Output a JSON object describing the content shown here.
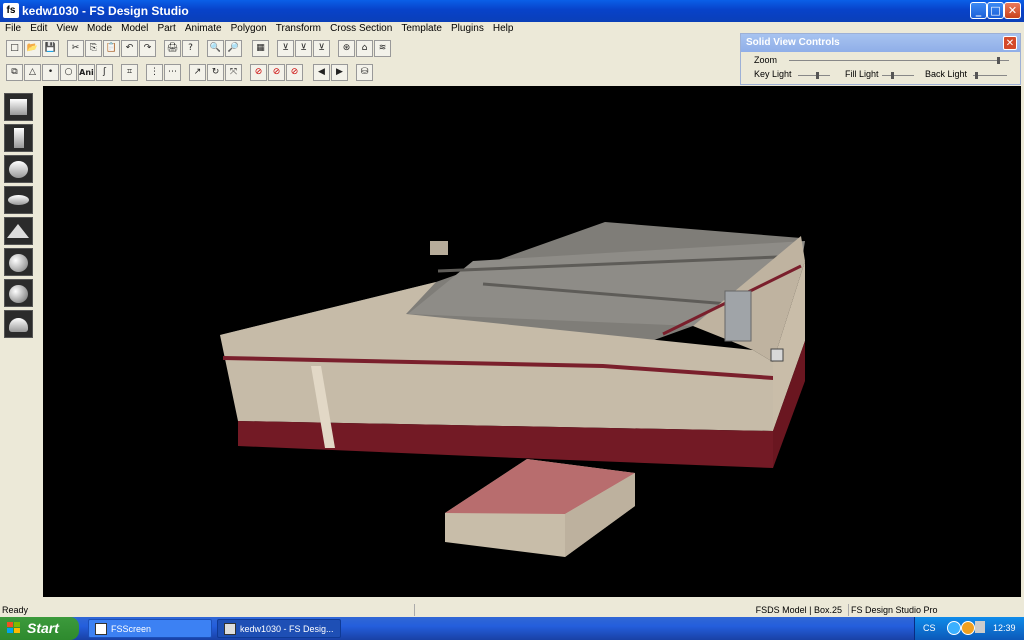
{
  "window": {
    "title": "kedw1030 - FS Design Studio",
    "app_icon_text": "fs",
    "min": "_",
    "max": "□",
    "close": "✕"
  },
  "menu": [
    "File",
    "Edit",
    "View",
    "Mode",
    "Model",
    "Part",
    "Animate",
    "Polygon",
    "Transform",
    "Cross Section",
    "Template",
    "Plugins",
    "Help"
  ],
  "toolbar1": [
    "□",
    "📂",
    "💾",
    "✂",
    "⎘",
    "📋",
    "↶",
    "↷",
    "🖨",
    "?",
    "🔍",
    "🔎",
    "▦",
    "⊻",
    "⊻",
    "⊻",
    "⊛",
    "⌂",
    "≋"
  ],
  "toolbar2": [
    "⧉",
    "△",
    "•",
    "○",
    "Ani",
    "ʃ",
    "⌗",
    "⋮",
    "⋯",
    "↗",
    "↻",
    "⤧",
    "⊘",
    "⊘",
    "⊘",
    "◀",
    "▶",
    "⛁"
  ],
  "toolbar2_ani": "Ani",
  "solid_view_controls": {
    "title": "Solid View Controls",
    "close": "✕",
    "zoom_label": "Zoom",
    "key_light_label": "Key Light",
    "fill_light_label": "Fill Light",
    "back_light_label": "Back Light",
    "zoom_value": 0.95,
    "key_light_value": 0.6,
    "fill_light_value": 0.3,
    "back_light_value": 0.1
  },
  "left_tools": [
    "cube-tool",
    "cylinder-tool",
    "sphere-tool",
    "disc-tool",
    "pyramid-tool",
    "geosphere-tool",
    "geosphere2-tool",
    "dome-tool"
  ],
  "status": {
    "left": "Ready",
    "middle": "FSDS Model | Box.25",
    "right": "FS Design Studio Pro"
  },
  "taskbar": {
    "start": "Start",
    "tasks": [
      {
        "label": "FSScreen"
      },
      {
        "label": "kedw1030 - FS Desig..."
      }
    ],
    "tray_text": "CS",
    "clock": "12:39"
  },
  "colors": {
    "viewport": "#000000",
    "title_bar": "#0842C9",
    "wall": "#C7BBA8",
    "stripe": "#7A1F2C",
    "roof": "#8C8A84",
    "shed_roof": "#B76E6E"
  }
}
